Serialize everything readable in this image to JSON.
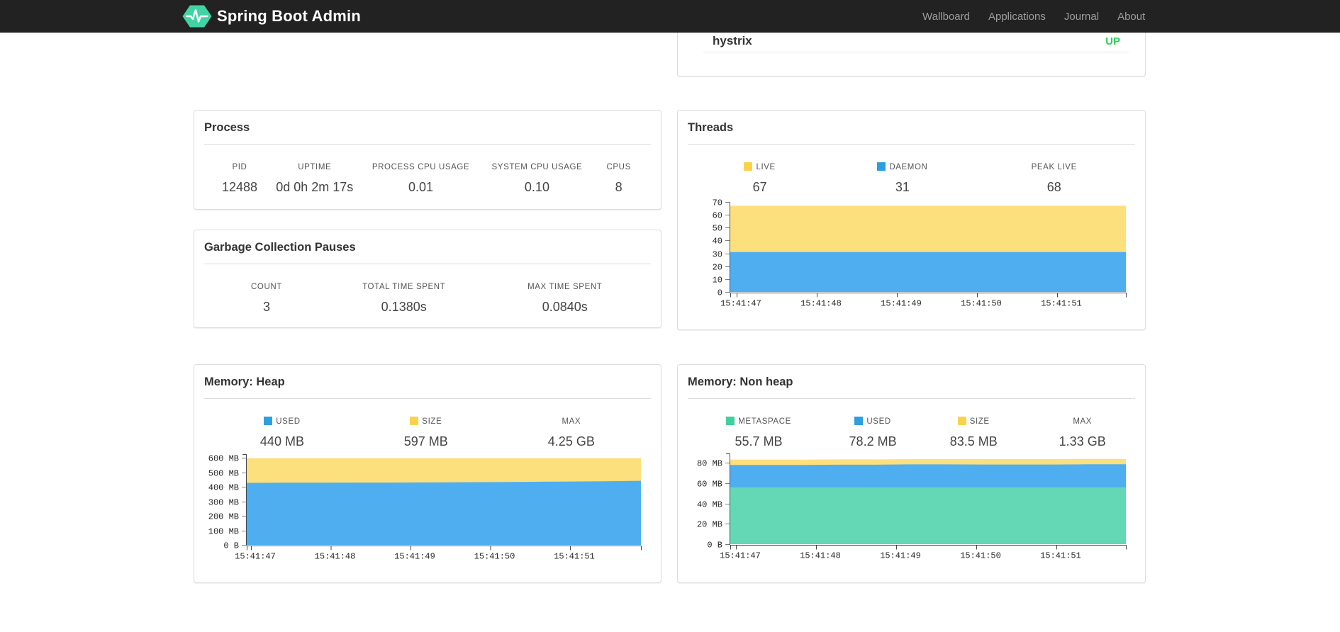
{
  "navbar": {
    "brand": "Spring Boot Admin",
    "links": [
      {
        "label": "Wallboard"
      },
      {
        "label": "Applications"
      },
      {
        "label": "Journal"
      },
      {
        "label": "About"
      }
    ]
  },
  "applications_panel": {
    "app_name": "hystrix",
    "app_status": "UP",
    "status_color": "#2ED058"
  },
  "process": {
    "title": "Process",
    "metrics": [
      {
        "label": "PID",
        "value": "12488"
      },
      {
        "label": "UPTIME",
        "value": "0d 0h 2m 17s"
      },
      {
        "label": "PROCESS CPU USAGE",
        "value": "0.01"
      },
      {
        "label": "SYSTEM CPU USAGE",
        "value": "0.10"
      },
      {
        "label": "CPUS",
        "value": "8"
      }
    ]
  },
  "gc": {
    "title": "Garbage Collection Pauses",
    "metrics": [
      {
        "label": "COUNT",
        "value": "3"
      },
      {
        "label": "TOTAL TIME SPENT",
        "value": "0.1380s"
      },
      {
        "label": "MAX TIME SPENT",
        "value": "0.0840s"
      }
    ]
  },
  "threads": {
    "title": "Threads",
    "metrics": [
      {
        "label": "LIVE",
        "value": "67",
        "swatch": "#FBD34B"
      },
      {
        "label": "DAEMON",
        "value": "31",
        "swatch": "#2D9FE0"
      },
      {
        "label": "PEAK LIVE",
        "value": "68"
      }
    ]
  },
  "heap": {
    "title": "Memory: Heap",
    "metrics": [
      {
        "label": "USED",
        "value": "440 MB",
        "swatch": "#2D9FE0"
      },
      {
        "label": "SIZE",
        "value": "597 MB",
        "swatch": "#FBD34B"
      },
      {
        "label": "MAX",
        "value": "4.25 GB"
      }
    ]
  },
  "nonheap": {
    "title": "Memory: Non heap",
    "metrics": [
      {
        "label": "METASPACE",
        "value": "55.7 MB",
        "swatch": "#42CFA0"
      },
      {
        "label": "USED",
        "value": "78.2 MB",
        "swatch": "#2D9FE0"
      },
      {
        "label": "SIZE",
        "value": "83.5 MB",
        "swatch": "#FBD34B"
      },
      {
        "label": "MAX",
        "value": "1.33 GB"
      }
    ]
  },
  "chart_data": [
    {
      "id": "threads",
      "type": "area",
      "title": "Threads",
      "x": [
        "15:41:47",
        "15:41:48",
        "15:41:49",
        "15:41:50",
        "15:41:51"
      ],
      "ylim": [
        0,
        70
      ],
      "yticks": [
        {
          "label": "0",
          "value": 0
        },
        {
          "label": "10",
          "value": 10
        },
        {
          "label": "20",
          "value": 20
        },
        {
          "label": "30",
          "value": 30
        },
        {
          "label": "40",
          "value": 40
        },
        {
          "label": "50",
          "value": 50
        },
        {
          "label": "60",
          "value": 60
        },
        {
          "label": "70",
          "value": 70
        }
      ],
      "series": [
        {
          "name": "LIVE",
          "fill": "#FDE07E",
          "values": [
            67,
            67,
            67,
            67,
            67,
            67,
            67,
            67,
            67,
            67,
            67,
            67
          ]
        },
        {
          "name": "DAEMON",
          "fill": "#4FAEF0",
          "values": [
            31,
            31,
            31,
            31,
            31,
            31,
            31,
            31,
            31,
            31,
            31,
            31
          ]
        }
      ]
    },
    {
      "id": "heap",
      "type": "area",
      "title": "Memory: Heap",
      "x": [
        "15:41:47",
        "15:41:48",
        "15:41:49",
        "15:41:50",
        "15:41:51"
      ],
      "ylim": [
        0,
        600
      ],
      "yticks": [
        {
          "label": "0 B",
          "value": 0
        },
        {
          "label": "100 MB",
          "value": 100
        },
        {
          "label": "200 MB",
          "value": 200
        },
        {
          "label": "300 MB",
          "value": 300
        },
        {
          "label": "400 MB",
          "value": 400
        },
        {
          "label": "500 MB",
          "value": 500
        },
        {
          "label": "600 MB",
          "value": 600
        }
      ],
      "series": [
        {
          "name": "SIZE",
          "fill": "#FDE07E",
          "values": [
            597,
            597,
            597,
            597,
            597,
            597,
            597,
            597,
            597,
            597,
            597,
            597
          ]
        },
        {
          "name": "USED",
          "fill": "#4FAEF0",
          "values": [
            427,
            428,
            428,
            429,
            429,
            430,
            431,
            432,
            434,
            436,
            438,
            441
          ]
        }
      ]
    },
    {
      "id": "nonheap",
      "type": "area",
      "title": "Memory: Non heap",
      "x": [
        "15:41:47",
        "15:41:48",
        "15:41:49",
        "15:41:50",
        "15:41:51"
      ],
      "ylim": [
        0,
        80
      ],
      "yticks": [
        {
          "label": "0 B",
          "value": 0
        },
        {
          "label": "20 MB",
          "value": 20
        },
        {
          "label": "40 MB",
          "value": 40
        },
        {
          "label": "60 MB",
          "value": 60
        },
        {
          "label": "80 MB",
          "value": 80
        }
      ],
      "series": [
        {
          "name": "SIZE",
          "fill": "#FDE07E",
          "values": [
            83.0,
            83.0,
            83.0,
            83.2,
            83.2,
            83.5,
            83.5,
            83.5,
            83.5,
            83.5,
            83.7,
            83.7
          ]
        },
        {
          "name": "USED",
          "fill": "#4FAEF0",
          "values": [
            77.8,
            77.8,
            77.8,
            78.0,
            78.0,
            78.3,
            78.3,
            78.2,
            78.2,
            78.2,
            78.4,
            78.4
          ]
        },
        {
          "name": "METASPACE",
          "fill": "#64D7B5",
          "values": [
            55.7,
            55.7,
            55.7,
            55.7,
            55.7,
            55.7,
            55.7,
            55.7,
            55.7,
            55.7,
            55.7,
            55.7
          ]
        }
      ]
    }
  ]
}
